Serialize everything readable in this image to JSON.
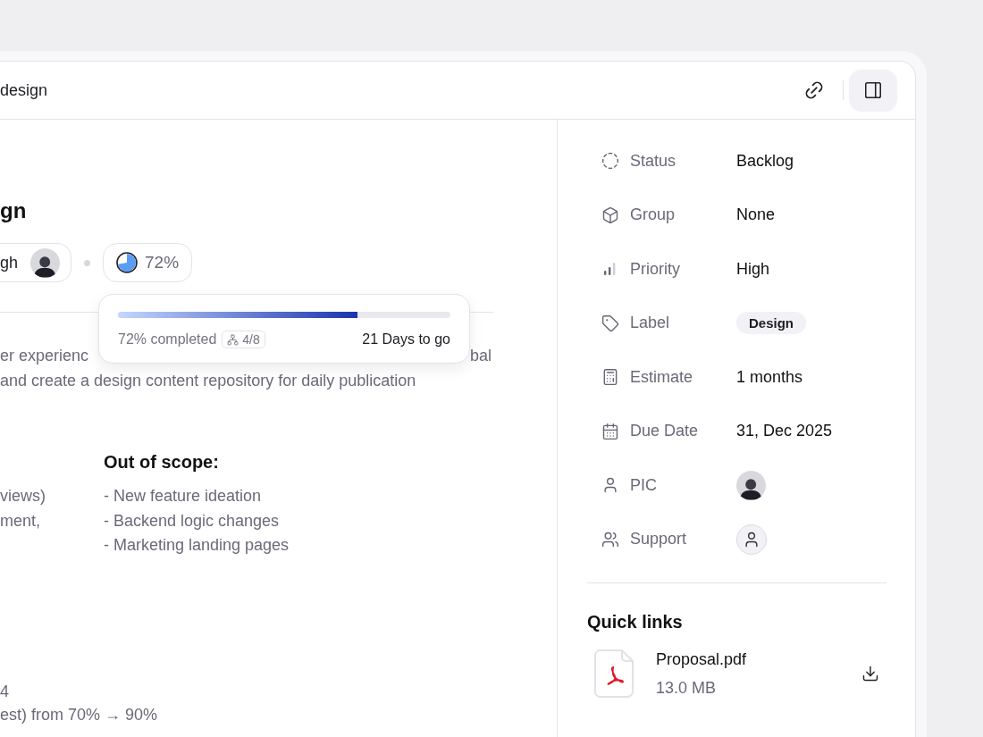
{
  "header": {
    "title": "design"
  },
  "task": {
    "title": "gn",
    "assignee_chip": {
      "label": "gh"
    },
    "progress_chip": {
      "label": "72%"
    }
  },
  "progress_popover": {
    "level": 0.72,
    "completed": "72% completed",
    "subtasks": "4/8",
    "due": "21 Days to go"
  },
  "description": {
    "line_1_start": "er experienc",
    "line_1_end": "bal",
    "line_2": "and create a design content repository for daily publication"
  },
  "scope": {
    "column_1_items": [
      "views)",
      "ment,"
    ],
    "out_of_scope": {
      "title": "Out of scope:",
      "items": [
        "- New feature ideation",
        "- Backend logic changes",
        "- Marketing landing pages"
      ]
    }
  },
  "goals": {
    "lines": [
      "4",
      "est) from 70% → 90%"
    ]
  },
  "properties": [
    {
      "kind": "text",
      "label": "Status",
      "value": "Backlog"
    },
    {
      "kind": "text",
      "label": "Group",
      "value": "None"
    },
    {
      "kind": "text",
      "label": "Priority",
      "value": "High"
    },
    {
      "kind": "tag",
      "label": "Label",
      "value": "Design"
    },
    {
      "kind": "text",
      "label": "Estimate",
      "value": "1 months"
    },
    {
      "kind": "text",
      "label": "Due Date",
      "value": "31, Dec 2025"
    },
    {
      "kind": "avatar",
      "label": "PIC"
    },
    {
      "kind": "empty-avatar",
      "label": "Support"
    }
  ],
  "quick_links": {
    "title": "Quick links",
    "files": [
      {
        "name": "Proposal.pdf",
        "size": "13.0 MB"
      }
    ]
  }
}
